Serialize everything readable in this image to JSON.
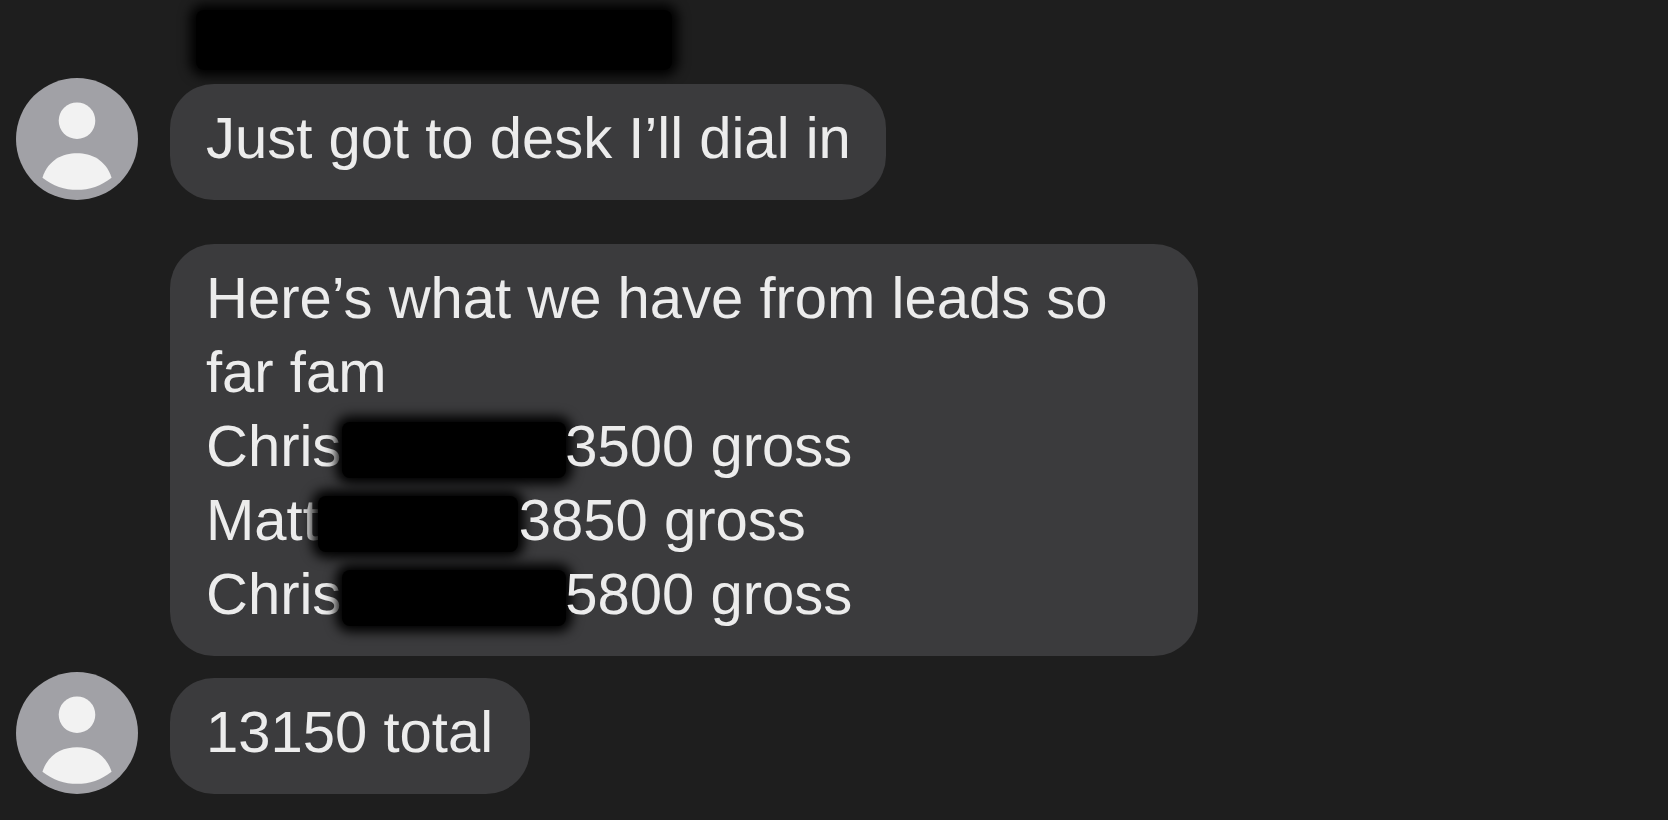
{
  "sender": {
    "redacted": true
  },
  "messages": [
    {
      "kind": "text",
      "avatar": true,
      "text": "Just got to desk I’ll dial in"
    },
    {
      "kind": "list",
      "avatar": false,
      "text": "Here’s what we have from leads so far fam",
      "lines": [
        {
          "name": "Chris",
          "amount": "3500 gross"
        },
        {
          "name": "Matt",
          "amount": "3850 gross"
        },
        {
          "name": "Chris",
          "amount": "5800 gross"
        }
      ]
    },
    {
      "kind": "text",
      "avatar": true,
      "text": "13150 total"
    }
  ]
}
